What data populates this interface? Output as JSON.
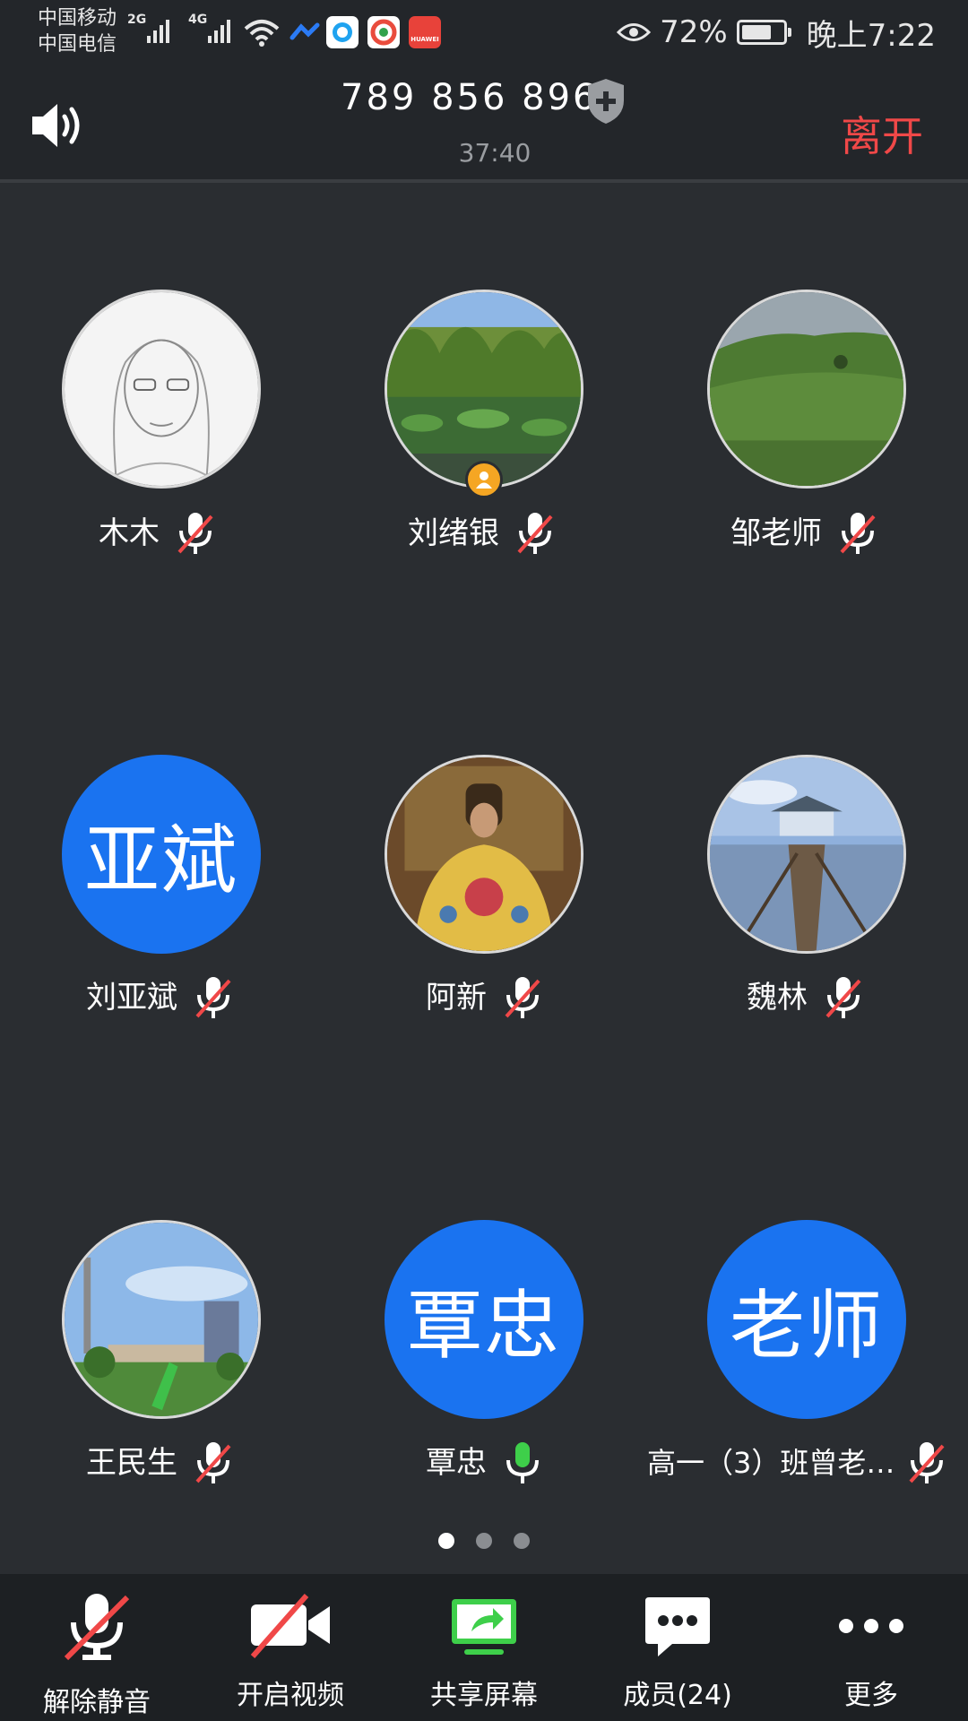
{
  "status_bar": {
    "carrier1": "中国移动",
    "carrier2": "中国电信",
    "net1": "2G",
    "net2": "4G",
    "battery_percent": "72%",
    "battery_level": 0.72,
    "time": "晚上7:22",
    "icons": [
      "signal-icon",
      "wifi-icon",
      "cloud-icon",
      "qq-icon",
      "browser-icon",
      "huawei-icon",
      "eye-icon",
      "battery-icon"
    ],
    "huawei_label": "HUAWEI"
  },
  "header": {
    "meeting_id": "789 856 896",
    "timer": "37:40",
    "leave_label": "离开"
  },
  "participants": [
    {
      "name": "木木",
      "avatar": "photo-sketch",
      "muted": true
    },
    {
      "name": "刘绪银",
      "avatar": "photo-lotus",
      "muted": true,
      "host": true
    },
    {
      "name": "邹老师",
      "avatar": "photo-hill",
      "muted": true
    },
    {
      "name": "刘亚斌",
      "avatar_text": "亚斌",
      "muted": true
    },
    {
      "name": "阿新",
      "avatar": "photo-robe",
      "muted": true
    },
    {
      "name": "魏林",
      "avatar": "photo-pier",
      "muted": true
    },
    {
      "name": "王民生",
      "avatar": "photo-campus",
      "muted": true
    },
    {
      "name": "覃忠",
      "avatar_text": "覃忠",
      "muted": false
    },
    {
      "name": "高一（3）班曾老…",
      "avatar_text": "老师",
      "muted": true
    }
  ],
  "pager": {
    "pages": 3,
    "current": 1
  },
  "toolbar": {
    "unmute_label": "解除静音",
    "video_label": "开启视频",
    "share_label": "共享屏幕",
    "members_label": "成员(24)",
    "more_label": "更多"
  },
  "colors": {
    "background": "#2a2d31",
    "accent_blue": "#1a73f0",
    "leave_red": "#f04848",
    "mic_green": "#3ecf4a",
    "host_orange": "#f5a623"
  }
}
